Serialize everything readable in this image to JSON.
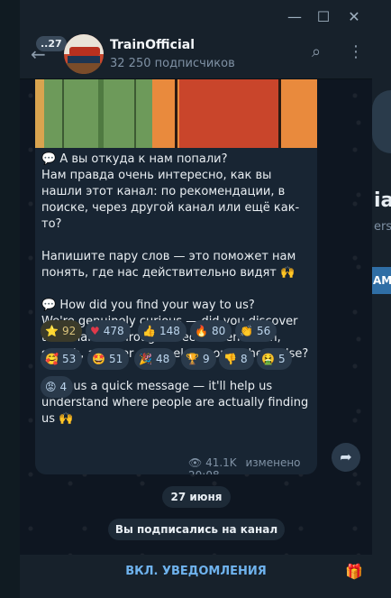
{
  "titlebar": {
    "minimize_icon": "—",
    "maximize_icon": "☐",
    "close_icon": "✕"
  },
  "header": {
    "unread_count": "..27",
    "channel_name": "TrainOfficial",
    "subscribers": "32 250 подписчиков",
    "search_icon": "⌕",
    "menu_icon": "⋮"
  },
  "message": {
    "text": "💬 А вы откуда к нам попали?\nНам правда очень интересно, как вы нашли этот канал: по рекомендации, в поиске, через другой канал или ещё как-то?\n\nНапишите пару слов — это поможет нам понять, где нас действительно видят 🙌\n\n💬 How did you find your way to us?\nWe're genuinely curious — did you discover this channel through a recommendation, search, another channel, or somewhere else?\n\nDrop us a quick message — it'll help us understand where people are actually finding us 🙌",
    "reactions": [
      {
        "emoji": "⭐",
        "count": "92"
      },
      {
        "emoji": "♥",
        "count": "478"
      },
      {
        "emoji": "👍",
        "count": "148"
      },
      {
        "emoji": "🔥",
        "count": "80"
      },
      {
        "emoji": "👏",
        "count": "56"
      },
      {
        "emoji": "🥰",
        "count": "53"
      },
      {
        "emoji": "🤩",
        "count": "51"
      },
      {
        "emoji": "🎉",
        "count": "48"
      },
      {
        "emoji": "🏆",
        "count": "9"
      },
      {
        "emoji": "👎",
        "count": "8"
      },
      {
        "emoji": "🤮",
        "count": "5"
      },
      {
        "emoji": "😡",
        "count": "4"
      }
    ],
    "views": "41.1K",
    "edited_time": "изменено 20:08"
  },
  "date_pill": "27 июня",
  "service_message": "Вы подписались на канал",
  "bottom": {
    "notify_label": "ВКЛ. УВЕДОМЛЕНИЯ"
  },
  "background_app": {
    "heading_fragment": "ia",
    "sub_fragment": "ers",
    "button_fragment": "AM"
  },
  "colors": {
    "accent": "#6fb3ee",
    "bubble": "#182533",
    "panel": "#17212b"
  }
}
